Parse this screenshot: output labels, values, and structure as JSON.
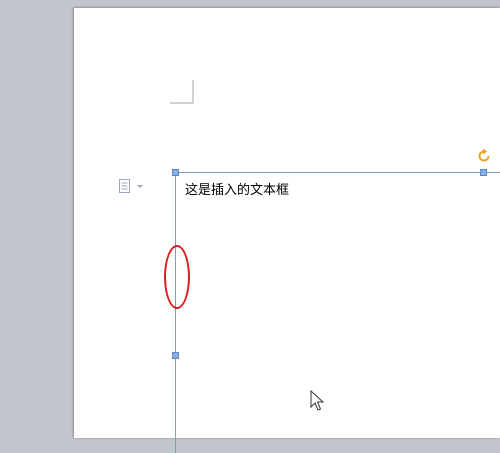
{
  "document": {
    "textbox_text": "这是插入的文本框"
  },
  "icons": {
    "paragraph": "paragraph-options-icon",
    "rotate": "rotate-handle-icon",
    "cursor": "mouse-pointer-icon"
  },
  "colors": {
    "workspace": "#c2c5cb",
    "page": "#ffffff",
    "textbox_border": "#7f9db9",
    "handle": "#8ab0e0",
    "rotate_handle": "#f0a020",
    "annotation": "#d81e1e"
  }
}
